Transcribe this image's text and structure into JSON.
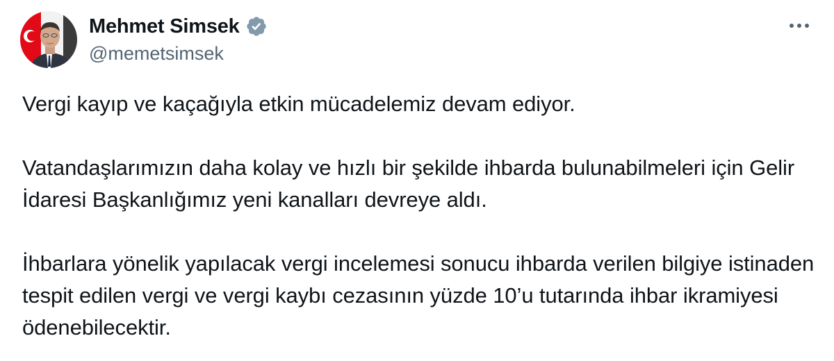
{
  "author": {
    "display_name": "Mehmet Simsek",
    "handle": "@memetsimsek",
    "verified": true,
    "avatar": "profile-photo"
  },
  "icons": {
    "verified": "verified-badge-icon",
    "more": "more-options-icon"
  },
  "colors": {
    "text_primary": "#0f1419",
    "text_secondary": "#536471",
    "badge": "#829aab",
    "flag_red": "#e30a17"
  },
  "tweet": {
    "paragraphs": [
      "Vergi kayıp ve kaçağıyla etkin mücadelemiz devam ediyor.",
      "Vatandaşlarımızın daha kolay ve hızlı bir şekilde ihbarda bulunabilmeleri için Gelir İdaresi Başkanlığımız yeni kanalları devreye aldı.",
      "İhbarlara yönelik yapılacak vergi incelemesi sonucu ihbarda verilen bilgiye istinaden tespit edilen vergi ve vergi kaybı cezasının yüzde 10’u tutarında ihbar ikramiyesi ödenebilecektir."
    ]
  }
}
